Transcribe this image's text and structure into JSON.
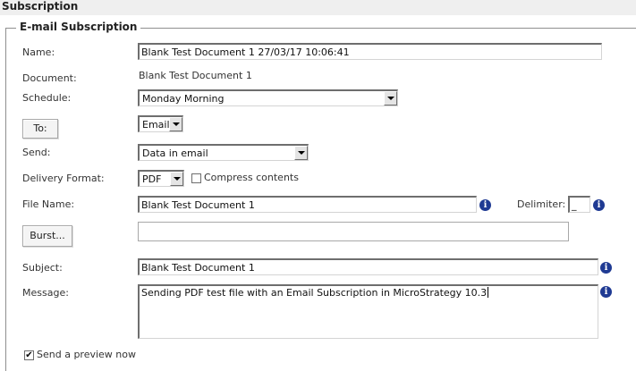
{
  "header": {
    "title": "Subscription"
  },
  "fieldset": {
    "legend": "E-mail Subscription"
  },
  "form": {
    "name_label": "Name:",
    "name_value": "Blank Test Document 1 27/03/17 10:06:41",
    "document_label": "Document:",
    "document_value": "Blank Test Document 1",
    "schedule_label": "Schedule:",
    "schedule_value": "Monday Morning",
    "to_button": "To:",
    "to_type_value": "Email",
    "send_label": "Send:",
    "send_value": "Data in email",
    "delivery_format_label": "Delivery Format:",
    "delivery_format_value": "PDF",
    "compress_label": "Compress contents",
    "compress_checked": false,
    "file_name_label": "File Name:",
    "file_name_value": "Blank Test Document 1",
    "delimiter_label": "Delimiter:",
    "delimiter_value": "_",
    "burst_button": "Burst...",
    "burst_value": "",
    "subject_label": "Subject:",
    "subject_value": "Blank Test Document 1",
    "message_label": "Message:",
    "message_value": "Sending PDF test file with an Email Subscription in MicroStrategy 10.3",
    "preview_label": "Send a preview now",
    "preview_checked": true
  },
  "icons": {
    "info": "info-icon",
    "info_glyph": "i"
  },
  "colors": {
    "info_icon": "#1f3a93",
    "header_bg": "#efefef"
  }
}
